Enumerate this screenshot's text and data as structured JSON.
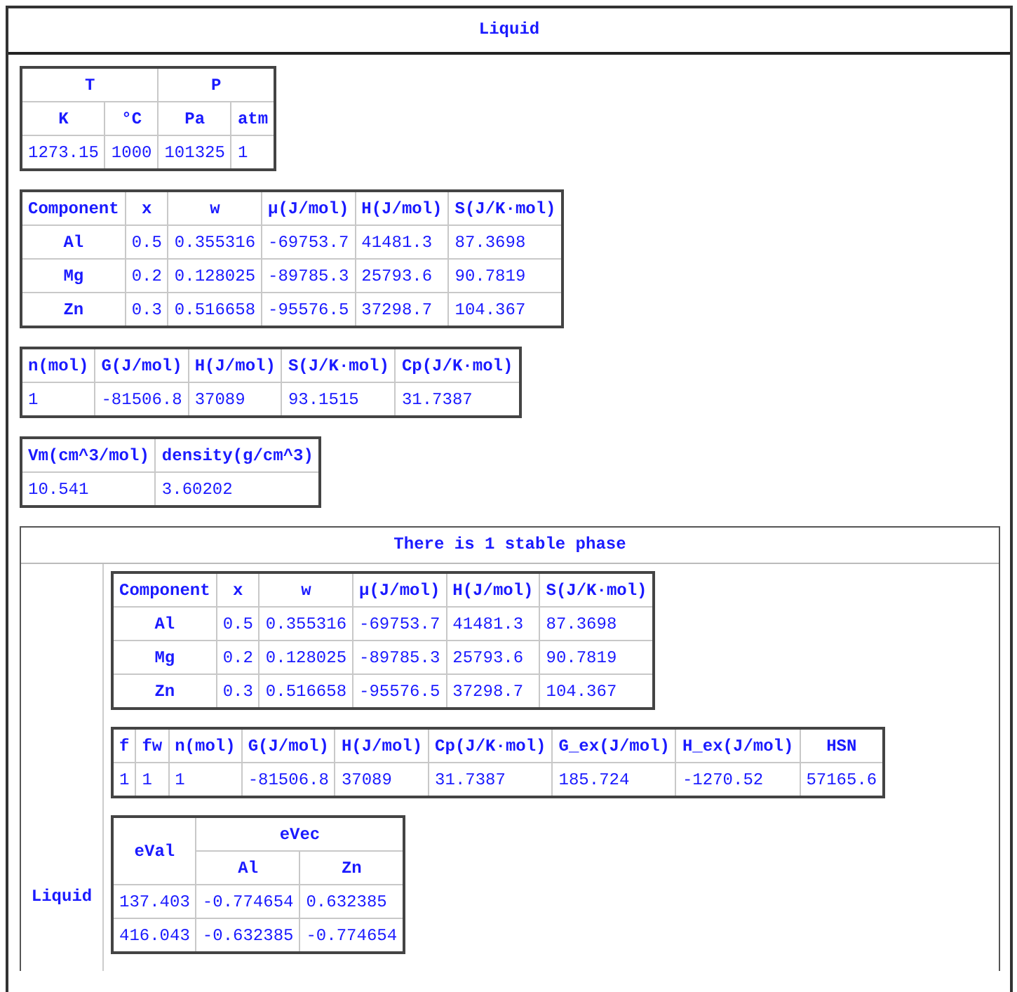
{
  "title": "Liquid",
  "tables": [
    {
      "kind": "grouped",
      "groups": [
        {
          "label": "T",
          "columns": [
            "K",
            "°C"
          ]
        },
        {
          "label": "P",
          "columns": [
            "Pa",
            "atm"
          ]
        }
      ],
      "rows": [
        [
          "1273.15",
          "1000",
          "101325",
          "1"
        ]
      ]
    },
    {
      "kind": "component",
      "columns": [
        "Component",
        "x",
        "w",
        "μ(J/mol)",
        "H(J/mol)",
        "S(J/K·mol)"
      ],
      "rows": [
        [
          "Al",
          "0.5",
          "0.355316",
          "-69753.7",
          "41481.3",
          "87.3698"
        ],
        [
          "Mg",
          "0.2",
          "0.128025",
          "-89785.3",
          "25793.6",
          "90.7819"
        ],
        [
          "Zn",
          "0.3",
          "0.516658",
          "-95576.5",
          "37298.7",
          "104.367"
        ]
      ]
    },
    {
      "kind": "plain",
      "columns": [
        "n(mol)",
        "G(J/mol)",
        "H(J/mol)",
        "S(J/K·mol)",
        "Cp(J/K·mol)"
      ],
      "rows": [
        [
          "1",
          "-81506.8",
          "37089",
          "93.1515",
          "31.7387"
        ]
      ]
    },
    {
      "kind": "plain",
      "columns": [
        "Vm(cm^3/mol)",
        "density(g/cm^3)"
      ],
      "rows": [
        [
          "10.541",
          "3.60202"
        ]
      ]
    }
  ],
  "stable_phases": {
    "title": "There is 1 stable phase",
    "phases": [
      {
        "name": "Liquid",
        "tables": [
          {
            "kind": "component",
            "columns": [
              "Component",
              "x",
              "w",
              "μ(J/mol)",
              "H(J/mol)",
              "S(J/K·mol)"
            ],
            "rows": [
              [
                "Al",
                "0.5",
                "0.355316",
                "-69753.7",
                "41481.3",
                "87.3698"
              ],
              [
                "Mg",
                "0.2",
                "0.128025",
                "-89785.3",
                "25793.6",
                "90.7819"
              ],
              [
                "Zn",
                "0.3",
                "0.516658",
                "-95576.5",
                "37298.7",
                "104.367"
              ]
            ]
          },
          {
            "kind": "plain",
            "columns": [
              "f",
              "fw",
              "n(mol)",
              "G(J/mol)",
              "H(J/mol)",
              "Cp(J/K·mol)",
              "G_ex(J/mol)",
              "H_ex(J/mol)",
              "HSN"
            ],
            "rows": [
              [
                "1",
                "1",
                "1",
                "-81506.8",
                "37089",
                "31.7387",
                "185.724",
                "-1270.52",
                "57165.6"
              ]
            ]
          },
          {
            "kind": "grouped",
            "groups": [
              {
                "label": "eVal"
              },
              {
                "label": "eVec",
                "columns": [
                  "Al",
                  "Zn"
                ]
              }
            ],
            "rows": [
              [
                "137.403",
                "-0.774654",
                "0.632385"
              ],
              [
                "416.043",
                "-0.632385",
                "-0.774654"
              ]
            ]
          }
        ]
      }
    ]
  }
}
